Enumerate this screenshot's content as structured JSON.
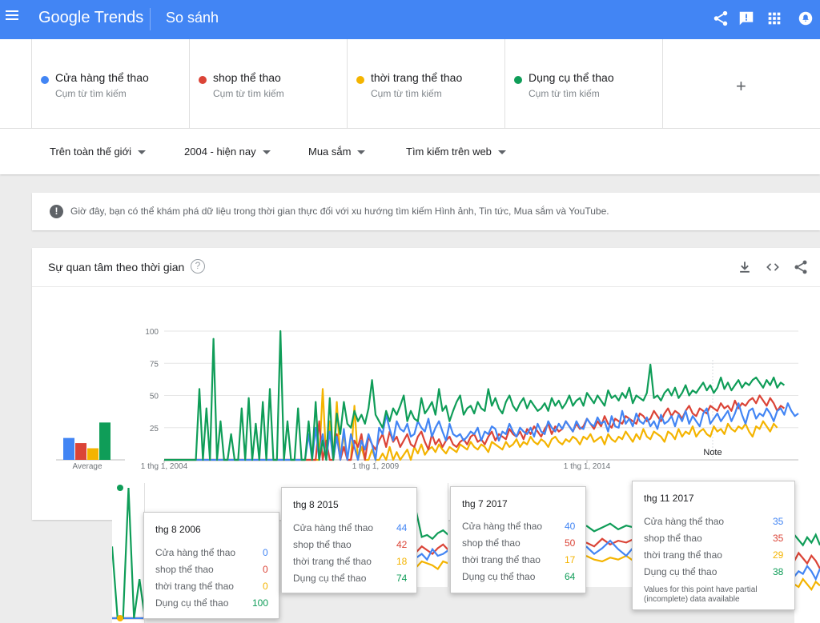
{
  "header": {
    "logo_google": "Google",
    "logo_trends": "Trends",
    "page_title": "So sánh",
    "icons": [
      "menu-icon",
      "share-icon",
      "feedback-icon",
      "apps-icon",
      "account-icon"
    ]
  },
  "terms": [
    {
      "name": "Cửa hàng thể thao",
      "type": "Cụm từ tìm kiếm",
      "color": "#4285f4"
    },
    {
      "name": "shop thể thao",
      "type": "Cụm từ tìm kiếm",
      "color": "#db4437"
    },
    {
      "name": "thời trang thể thao",
      "type": "Cụm từ tìm kiếm",
      "color": "#f4b400"
    },
    {
      "name": "Dụng cụ thể thao",
      "type": "Cụm từ tìm kiếm",
      "color": "#0f9d58"
    }
  ],
  "add_term": "+",
  "filters": {
    "region": "Trên toàn thế giới",
    "period": "2004 - hiện nay",
    "category": "Mua sắm",
    "search_type": "Tìm kiếm trên web"
  },
  "notice": {
    "icon": "!",
    "text": "Giờ đây, bạn có thể khám phá dữ liệu trong thời gian thực đối với xu hướng tìm kiếm Hình ảnh, Tin tức, Mua sắm và YouTube."
  },
  "card": {
    "title": "Sự quan tâm theo thời gian",
    "help": "?",
    "icons": [
      "download-icon",
      "embed-icon",
      "share-icon"
    ]
  },
  "chart_data": {
    "type": "line",
    "ylim": [
      0,
      100
    ],
    "yticks": [
      "100",
      "75",
      "50",
      "25"
    ],
    "xticks": [
      "1 thg 1, 2004",
      "1 thg 1, 2009",
      "1 thg 1, 2014"
    ],
    "average_label": "Average",
    "average": [
      17,
      13,
      9,
      29
    ],
    "note_label": "Note",
    "series": [
      {
        "name": "Cửa hàng thể thao",
        "color": "#4285f4",
        "values": [
          0,
          0,
          0,
          0,
          0,
          0,
          0,
          0,
          0,
          0,
          0,
          0,
          0,
          0,
          0,
          0,
          0,
          0,
          0,
          0,
          0,
          0,
          0,
          0,
          0,
          0,
          0,
          0,
          0,
          0,
          0,
          0,
          0,
          0,
          0,
          0,
          0,
          0,
          0,
          0,
          0,
          20,
          0,
          25,
          0,
          20,
          0,
          22,
          0,
          18,
          0,
          24,
          0,
          20,
          10,
          0,
          15,
          8,
          20,
          12,
          0,
          25,
          20,
          35,
          24,
          15,
          30,
          24,
          22,
          28,
          18,
          20,
          30,
          25,
          22,
          32,
          18,
          25,
          30,
          22,
          15,
          28,
          20,
          18,
          20,
          15,
          18,
          22,
          20,
          25,
          15,
          22,
          20,
          26,
          24,
          15,
          22,
          20,
          28,
          22,
          18,
          25,
          22,
          20,
          25,
          18,
          28,
          22,
          20,
          30,
          25,
          22,
          28,
          24,
          30,
          26,
          22,
          30,
          25,
          24,
          32,
          28,
          26,
          33,
          28,
          30,
          22,
          34,
          26,
          25,
          38,
          28,
          32,
          26,
          36,
          30,
          28,
          33,
          26,
          30,
          24,
          35,
          28,
          30,
          34,
          26,
          35,
          30,
          38,
          28,
          34,
          30,
          26,
          36,
          40,
          28,
          32,
          36,
          30,
          34,
          38,
          30,
          36,
          44,
          35,
          28,
          38,
          40,
          32,
          36,
          34,
          40,
          36,
          30,
          38,
          40,
          35,
          44,
          38,
          34,
          36
        ]
      },
      {
        "name": "shop thể thao",
        "color": "#db4437",
        "values": [
          0,
          0,
          0,
          0,
          0,
          0,
          0,
          0,
          0,
          0,
          0,
          0,
          0,
          0,
          0,
          0,
          0,
          0,
          0,
          0,
          0,
          0,
          0,
          0,
          0,
          0,
          0,
          0,
          0,
          0,
          0,
          0,
          0,
          0,
          0,
          0,
          0,
          0,
          0,
          0,
          0,
          0,
          0,
          0,
          30,
          0,
          15,
          0,
          0,
          20,
          0,
          10,
          0,
          0,
          15,
          10,
          20,
          0,
          18,
          12,
          8,
          15,
          20,
          10,
          22,
          14,
          18,
          10,
          15,
          20,
          12,
          10,
          18,
          22,
          14,
          8,
          20,
          12,
          16,
          10,
          15,
          18,
          12,
          10,
          14,
          16,
          12,
          18,
          20,
          14,
          16,
          12,
          18,
          22,
          15,
          20,
          18,
          16,
          24,
          20,
          18,
          22,
          16,
          24,
          20,
          26,
          22,
          18,
          24,
          28,
          20,
          26,
          22,
          24,
          30,
          26,
          22,
          28,
          24,
          26,
          32,
          28,
          24,
          30,
          26,
          34,
          28,
          25,
          32,
          30,
          28,
          34,
          32,
          30,
          28,
          36,
          34,
          30,
          32,
          38,
          34,
          30,
          36,
          40,
          34,
          38,
          36,
          32,
          38,
          42,
          36,
          34,
          40,
          38,
          36,
          42,
          40,
          38,
          44,
          40,
          42,
          38,
          46,
          40,
          44,
          42,
          46,
          48,
          44,
          50,
          46,
          42,
          48,
          44,
          38,
          42,
          40
        ]
      },
      {
        "name": "thời trang thể thao",
        "color": "#f4b400",
        "values": [
          0,
          0,
          0,
          0,
          0,
          0,
          0,
          0,
          0,
          0,
          0,
          0,
          0,
          0,
          0,
          0,
          0,
          0,
          0,
          0,
          0,
          0,
          0,
          0,
          0,
          0,
          0,
          0,
          0,
          0,
          0,
          0,
          0,
          0,
          0,
          0,
          0,
          0,
          0,
          0,
          0,
          0,
          0,
          0,
          0,
          55,
          0,
          30,
          0,
          45,
          0,
          20,
          0,
          0,
          42,
          0,
          10,
          0,
          0,
          8,
          0,
          0,
          5,
          0,
          10,
          0,
          6,
          0,
          4,
          8,
          0,
          10,
          5,
          12,
          4,
          8,
          10,
          6,
          12,
          8,
          5,
          10,
          8,
          6,
          12,
          10,
          8,
          14,
          10,
          8,
          12,
          10,
          6,
          14,
          12,
          10,
          8,
          14,
          10,
          12,
          16,
          10,
          14,
          12,
          18,
          14,
          12,
          16,
          14,
          10,
          16,
          18,
          14,
          12,
          16,
          14,
          18,
          16,
          12,
          18,
          16,
          20,
          14,
          16,
          18,
          12,
          20,
          16,
          14,
          18,
          16,
          22,
          18,
          14,
          20,
          16,
          24,
          18,
          16,
          22,
          20,
          18,
          14,
          22,
          20,
          16,
          24,
          18,
          22,
          20,
          26,
          18,
          22,
          24,
          20,
          18,
          26,
          22,
          24,
          20,
          28,
          24,
          22,
          26,
          24,
          28,
          22,
          18,
          26,
          24,
          30,
          26,
          22,
          28,
          25
        ]
      },
      {
        "name": "Dụng cụ thể thao",
        "color": "#0f9d58",
        "values": [
          0,
          0,
          0,
          0,
          0,
          0,
          0,
          0,
          0,
          0,
          55,
          0,
          40,
          0,
          94,
          0,
          30,
          0,
          0,
          20,
          0,
          0,
          40,
          0,
          48,
          0,
          28,
          0,
          45,
          0,
          55,
          0,
          0,
          100,
          0,
          30,
          0,
          0,
          40,
          0,
          0,
          30,
          0,
          45,
          0,
          15,
          0,
          48,
          0,
          36,
          20,
          45,
          28,
          25,
          38,
          30,
          35,
          28,
          40,
          62,
          35,
          30,
          25,
          38,
          30,
          40,
          35,
          42,
          50,
          30,
          38,
          32,
          30,
          48,
          36,
          40,
          45,
          35,
          55,
          38,
          42,
          30,
          38,
          45,
          50,
          35,
          40,
          42,
          36,
          45,
          40,
          38,
          55,
          42,
          48,
          40,
          36,
          45,
          50,
          42,
          38,
          44,
          48,
          40,
          46,
          42,
          38,
          40,
          44,
          38,
          48,
          42,
          46,
          40,
          44,
          50,
          42,
          46,
          48,
          42,
          52,
          48,
          44,
          50,
          46,
          42,
          54,
          48,
          50,
          46,
          52,
          48,
          56,
          44,
          50,
          48,
          46,
          52,
          74,
          48,
          50,
          46,
          52,
          55,
          50,
          56,
          48,
          52,
          58,
          50,
          54,
          52,
          56,
          60,
          54,
          58,
          52,
          56,
          64,
          55,
          60,
          54,
          58,
          62,
          56,
          60,
          58,
          62,
          64,
          60,
          56,
          62,
          58,
          64,
          56,
          60,
          58
        ]
      }
    ]
  },
  "tooltips": [
    {
      "date": "thg 8 2006",
      "values": [
        "0",
        "0",
        "0",
        "100"
      ],
      "labels": [
        "Cửa hàng thể thao",
        "shop thể thao",
        "thời trang thể thao",
        "Dụng cụ thể thao"
      ]
    },
    {
      "date": "thg 8 2015",
      "values": [
        "44",
        "42",
        "18",
        "74"
      ],
      "labels": [
        "Cửa hàng thể thao",
        "shop thể thao",
        "thời trang thể thao",
        "Dụng cụ thể thao"
      ]
    },
    {
      "date": "thg 7 2017",
      "values": [
        "40",
        "50",
        "17",
        "64"
      ],
      "labels": [
        "Cửa hàng thể thao",
        "shop thể thao",
        "thời trang thể thao",
        "Dụng cụ thể thao"
      ]
    },
    {
      "date": "thg 11 2017",
      "values": [
        "35",
        "35",
        "29",
        "38"
      ],
      "labels": [
        "Cửa hàng thể thao",
        "shop thể thao",
        "thời trang thể thao",
        "Dụng cụ thể thao"
      ],
      "note": "Values for this point have partial (incomplete) data available"
    }
  ],
  "snippet_axis": [
    "1 thg 1, 2014",
    "1 thg 1, 2014",
    "1 thg 1, 2014"
  ]
}
